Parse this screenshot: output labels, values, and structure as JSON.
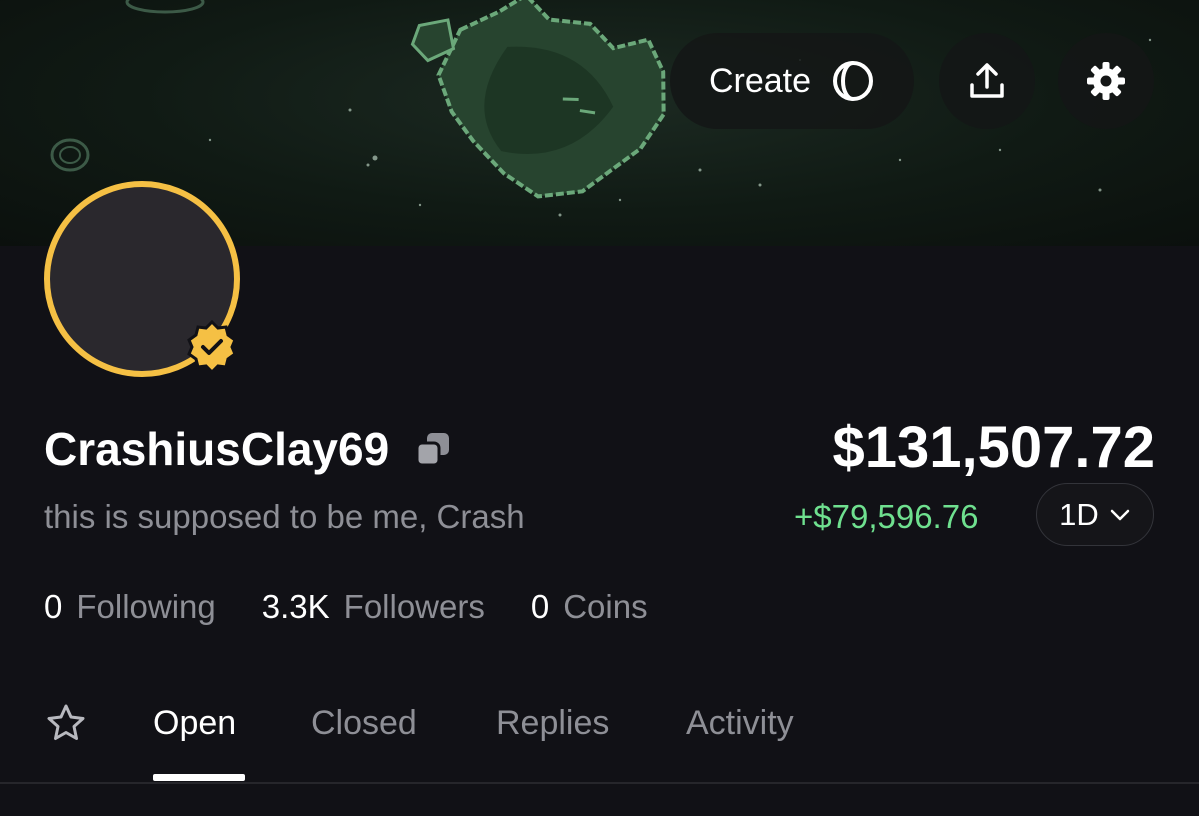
{
  "header": {
    "create_label": "Create",
    "icons": [
      "create-logo-icon",
      "share-icon",
      "gear-icon"
    ]
  },
  "profile": {
    "username": "CrashiusClay69",
    "bio": "this is supposed to be me, Crash",
    "accent": "#f5c044",
    "verified": true
  },
  "portfolio": {
    "balance": "$131,507.72",
    "change": "+$79,596.76",
    "change_color": "#6fe08f",
    "range": "1D"
  },
  "stats": [
    {
      "value": "0",
      "label": "Following"
    },
    {
      "value": "3.3K",
      "label": "Followers"
    },
    {
      "value": "0",
      "label": "Coins"
    }
  ],
  "tabs": [
    {
      "label": "Open",
      "active": true
    },
    {
      "label": "Closed",
      "active": false
    },
    {
      "label": "Replies",
      "active": false
    },
    {
      "label": "Activity",
      "active": false
    }
  ]
}
